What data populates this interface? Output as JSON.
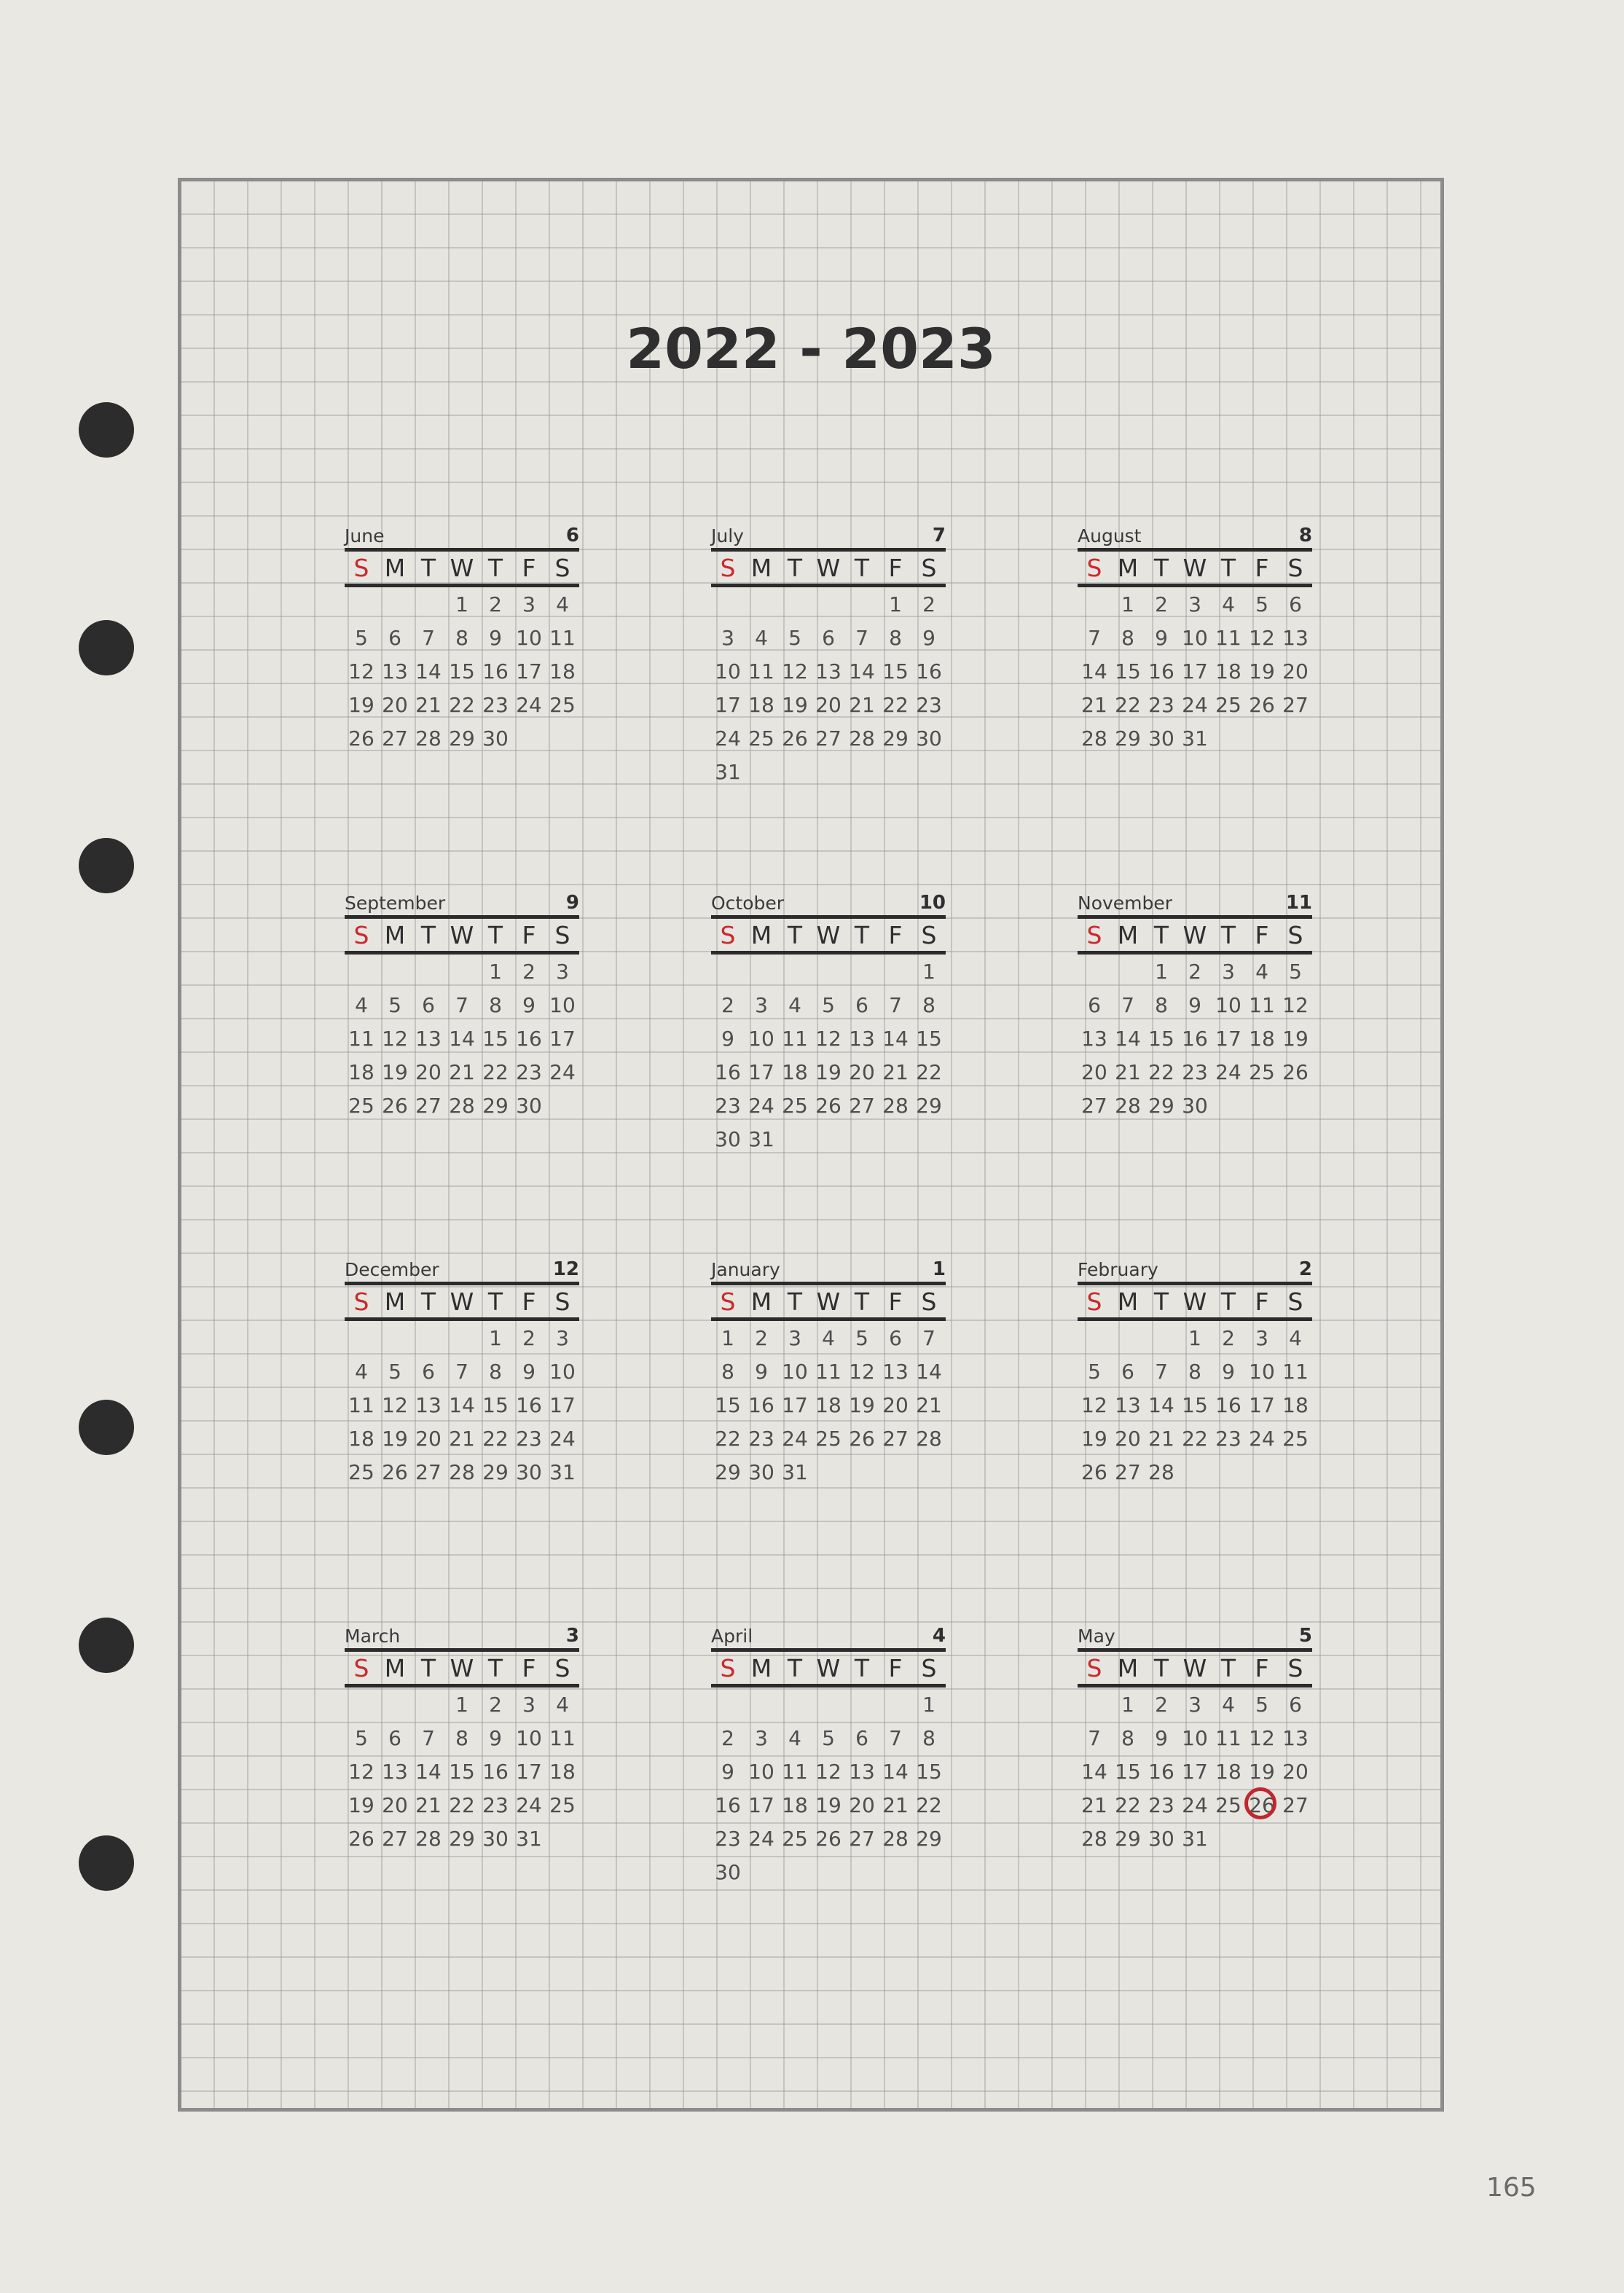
{
  "title": "2022 - 2023",
  "page_number": "165",
  "colors": {
    "sunday": "#c92a2e",
    "highlight_circle": "#c0282d"
  },
  "weekdays": [
    "S",
    "M",
    "T",
    "W",
    "T",
    "F",
    "S"
  ],
  "months": [
    {
      "name": "June",
      "number": "6",
      "offset": 3,
      "days": 30
    },
    {
      "name": "July",
      "number": "7",
      "offset": 5,
      "days": 31
    },
    {
      "name": "August",
      "number": "8",
      "offset": 1,
      "days": 31
    },
    {
      "name": "September",
      "number": "9",
      "offset": 4,
      "days": 30
    },
    {
      "name": "October",
      "number": "10",
      "offset": 6,
      "days": 31
    },
    {
      "name": "November",
      "number": "11",
      "offset": 2,
      "days": 30
    },
    {
      "name": "December",
      "number": "12",
      "offset": 4,
      "days": 31
    },
    {
      "name": "January",
      "number": "1",
      "offset": 0,
      "days": 31
    },
    {
      "name": "February",
      "number": "2",
      "offset": 3,
      "days": 28
    },
    {
      "name": "March",
      "number": "3",
      "offset": 3,
      "days": 31
    },
    {
      "name": "April",
      "number": "4",
      "offset": 6,
      "days": 30
    },
    {
      "name": "May",
      "number": "5",
      "offset": 1,
      "days": 31,
      "circled": 26
    }
  ]
}
